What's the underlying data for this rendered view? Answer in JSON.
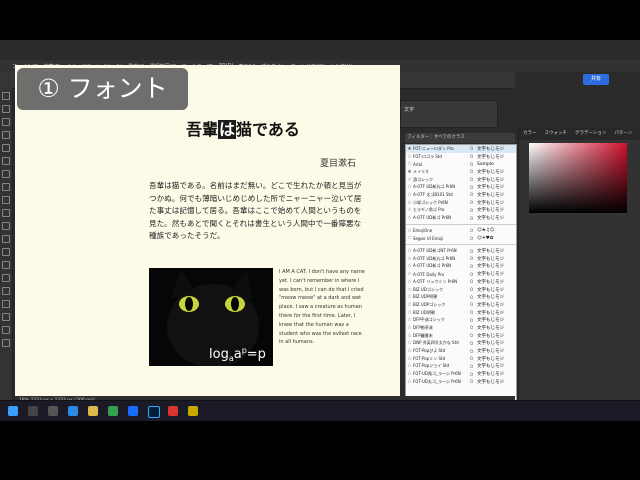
{
  "overlay": {
    "title": "① フォント"
  },
  "menu": [
    "ファイル(F)",
    "編集(E)",
    "イメージ(I)",
    "レイヤー(L)",
    "書式(Y)",
    "選択範囲(S)",
    "フィルター(T)",
    "3D(D)",
    "表示(V)",
    "プラグイン",
    "ウィンドウ(W)",
    "ヘルプ(H)"
  ],
  "options": {
    "share": "共有"
  },
  "document": {
    "title_pre": "吾輩",
    "title_hl": "は",
    "title_post": "猫である",
    "author": "夏目漱石",
    "body": "吾輩は猫である。名前はまだ無い。どこで生れたか頓と見当がつかぬ。何でも薄暗いじめじめした所でニャーニャー泣いて居た事丈は記憶して居る。吾輩はここで始めて人間というものを見た。然もあとで聞くとそれは書生という人間中で一番獰悪な種族であったそうだ。",
    "english": "I AM A CAT. I don't have any name yet. I can't remember in where I was born, but I can do that I cried \"meow meow\" at a dark and wet place. I saw a creature as human there for the first time. Later, I knew that the human was a student who was the evilest race in all humans.",
    "formula": "log_a a^p = p"
  },
  "character_panel": {
    "title": "文字",
    "filter": "フィルター：すべてのクラス",
    "label": "Adobe Fontsを追加："
  },
  "right_panel": {
    "tabs": [
      "カラー",
      "スウォッチ",
      "グラデーション",
      "パターン"
    ]
  },
  "fonts": [
    {
      "star": "★",
      "name": "FOT-ニューロダン Pro",
      "mark": "O",
      "sample": "文字もじモジ",
      "selected": true
    },
    {
      "star": "☆",
      "name": "FOT-ロゴラ Std",
      "mark": "O",
      "sample": "文字もじモジ"
    },
    {
      "star": "☆",
      "name": "Arial",
      "mark": "O",
      "sample": "Sample"
    },
    {
      "star": "★",
      "name": "メイリオ",
      "mark": "O",
      "sample": "文字もじモジ"
    },
    {
      "star": "☆",
      "name": "游ゴシック",
      "mark": "O",
      "sample": "文字もじモジ"
    },
    {
      "star": "☆",
      "name": "A-OTF UD新丸ゴ Pr6N",
      "mark": "O",
      "sample": "文字もじモジ"
    },
    {
      "star": "☆",
      "name": "A-OTF 太ゴB101 Std",
      "mark": "O",
      "sample": "文字もじモジ"
    },
    {
      "star": "☆",
      "name": "小塚ゴシック Pr6N",
      "mark": "O",
      "sample": "文字もじモジ"
    },
    {
      "star": "☆",
      "name": "ヒラギノ角ゴ Pro",
      "mark": "O",
      "sample": "文字もじモジ"
    },
    {
      "star": "☆",
      "name": "A-OTF UD新ゴ Pr6N",
      "mark": "O",
      "sample": "文字もじモジ"
    },
    {
      "divider": true
    },
    {
      "star": "☆",
      "name": "EmojiOne",
      "mark": "O",
      "sample": "☺★♫☺"
    },
    {
      "star": "☆",
      "name": "Segoe UI Emoji",
      "mark": "O",
      "sample": "☺☀♥✿"
    },
    {
      "divider": true
    },
    {
      "star": "☆",
      "name": "A-OTF UD新ゴNT Pr6N",
      "mark": "O",
      "sample": "文字もじモジ"
    },
    {
      "star": "☆",
      "name": "A-OTF UD新丸ゴ Pr6N",
      "mark": "O",
      "sample": "文字もじモジ"
    },
    {
      "star": "☆",
      "name": "A-OTF UD新ゴ Pr6N",
      "mark": "O",
      "sample": "文字もじモジ"
    },
    {
      "star": "☆",
      "name": "A-OTF Daily Pro",
      "mark": "O",
      "sample": "文字もじモジ"
    },
    {
      "star": "☆",
      "name": "A-OTF リュウミン Pr6N",
      "mark": "O",
      "sample": "文字もじモジ"
    },
    {
      "star": "☆",
      "name": "BIZ UDゴシック",
      "mark": "O",
      "sample": "文字もじモジ"
    },
    {
      "star": "☆",
      "name": "BIZ UDP明朝",
      "mark": "O",
      "sample": "文字もじモジ"
    },
    {
      "star": "☆",
      "name": "BIZ UDPゴシック",
      "mark": "O",
      "sample": "文字もじモジ"
    },
    {
      "star": "☆",
      "name": "BIZ UD明朝",
      "mark": "O",
      "sample": "文字もじモジ"
    },
    {
      "star": "☆",
      "name": "DFP平成ゴシック",
      "mark": "O",
      "sample": "文字もじモジ"
    },
    {
      "star": "☆",
      "name": "DFP勘亭流",
      "mark": "O",
      "sample": "文字もじモジ"
    },
    {
      "star": "☆",
      "name": "DFP麗雅宋",
      "mark": "O",
      "sample": "文字もじモジ"
    },
    {
      "star": "☆",
      "name": "DNP 秀英四号太かな Std",
      "mark": "O",
      "sample": "文字もじモジ"
    },
    {
      "star": "☆",
      "name": "FOT-Popびよ Std",
      "mark": "O",
      "sample": "文字もじモジ"
    },
    {
      "star": "☆",
      "name": "FOT-Popミン Std",
      "mark": "O",
      "sample": "文字もじモジ"
    },
    {
      "star": "☆",
      "name": "FOT-Popジョイ Std",
      "mark": "O",
      "sample": "文字もじモジ"
    },
    {
      "star": "☆",
      "name": "FOT-UD角ゴ_ラージ Pr6N",
      "mark": "O",
      "sample": "文字もじモジ"
    },
    {
      "star": "☆",
      "name": "FOT-UD丸ゴ_ラージ Pr6N",
      "mark": "O",
      "sample": "文字もじモジ"
    }
  ],
  "status": {
    "zoom": "18%",
    "size": "2333 px x 2333 px (300 ppi)"
  }
}
